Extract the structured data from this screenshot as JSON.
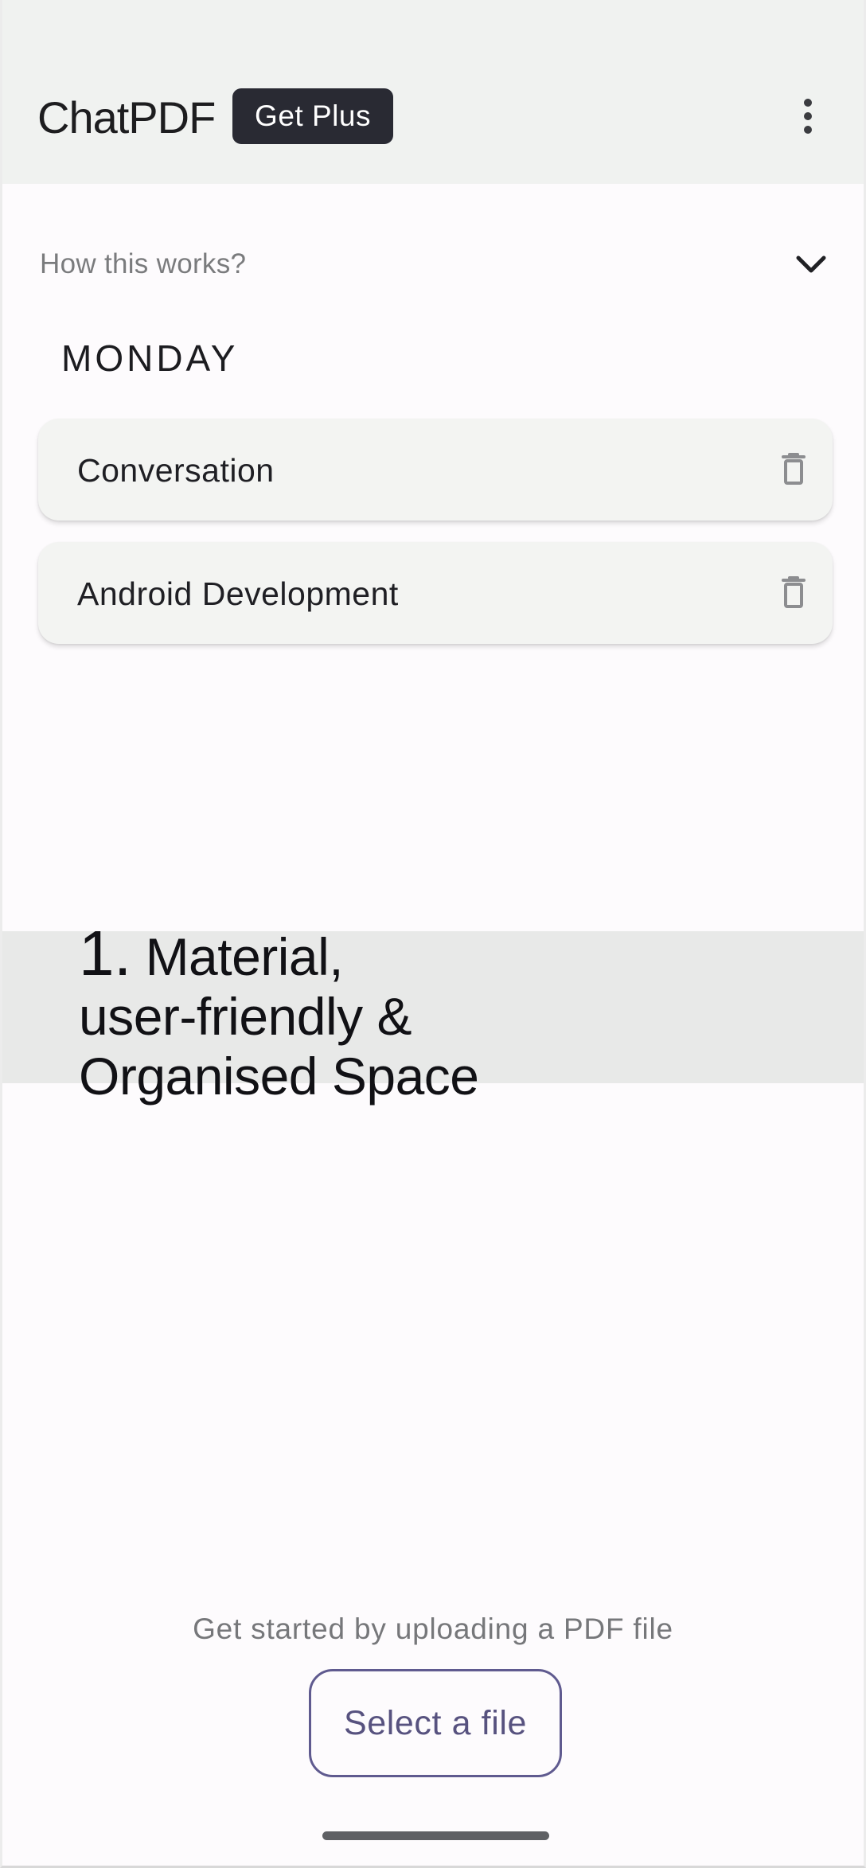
{
  "app": {
    "title": "ChatPDF",
    "plus_label": "Get Plus",
    "menu_icon": "more-vertical-icon"
  },
  "info": {
    "how_it_works": "How this works?",
    "chevron_icon": "chevron-down-icon"
  },
  "history": {
    "section_label": "MONDAY",
    "items": [
      {
        "title": "Conversation",
        "delete_icon": "trash-icon"
      },
      {
        "title": "Android Development",
        "delete_icon": "trash-icon"
      }
    ]
  },
  "feature": {
    "number": "1.",
    "line1": "Material,",
    "line2": "user-friendly &",
    "line3": "Organised Space"
  },
  "upload": {
    "helper_text": "Get started by uploading a PDF file",
    "button_label": "Select a file"
  },
  "colors": {
    "app_bar": "#f0f2f0",
    "primary_button": "#292a33",
    "accent": "#5f5a8f"
  }
}
